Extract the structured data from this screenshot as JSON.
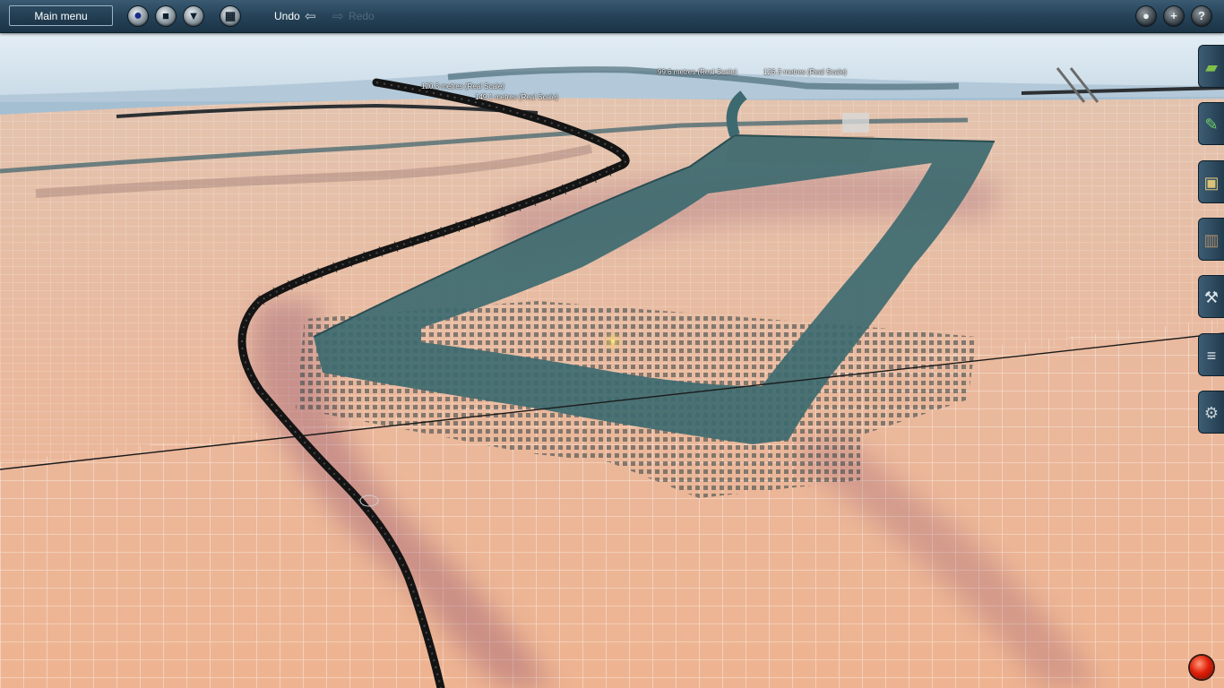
{
  "toolbar": {
    "main_menu_label": "Main menu",
    "undo_label": "Undo",
    "redo_label": "Redo",
    "left_icons": [
      {
        "name": "globe-icon",
        "glyph": "●"
      },
      {
        "name": "stop-icon",
        "glyph": "■"
      },
      {
        "name": "filter-icon",
        "glyph": "▼"
      },
      {
        "name": "grid-icon",
        "glyph": "▦"
      }
    ],
    "right_icons": [
      {
        "name": "camera-icon",
        "glyph": "●"
      },
      {
        "name": "plus-icon",
        "glyph": "+"
      },
      {
        "name": "help-icon",
        "glyph": "?"
      }
    ]
  },
  "side_panel": {
    "tools": [
      {
        "name": "terrain-tool-icon",
        "glyph": "▰",
        "color": "#7fbf4a"
      },
      {
        "name": "paint-tool-icon",
        "glyph": "✎",
        "color": "#6fcf6a"
      },
      {
        "name": "objects-tool-icon",
        "glyph": "▣",
        "color": "#d9c27a"
      },
      {
        "name": "track-tool-icon",
        "glyph": "▥",
        "color": "#a88a6a"
      },
      {
        "name": "settings-wrench-icon",
        "glyph": "⚒",
        "color": "#dce4ea"
      },
      {
        "name": "layers-icon",
        "glyph": "≡",
        "color": "#dce4ea"
      },
      {
        "name": "gear-icon",
        "glyph": "⚙",
        "color": "#c6d0d6"
      }
    ]
  },
  "measurements": [
    "99.6 metres  (Real Scale)",
    "126.3 metres  (Real Scale)",
    "120.3 metres  (Real Scale)",
    "149.1 metres  (Real Scale)"
  ],
  "colors": {
    "toolbar": "#27445a",
    "terrain": "#e9b89a",
    "water": "#3d6a70",
    "sky": "#cfe0ec",
    "track": "#141414",
    "record_button": "#e2200a"
  }
}
